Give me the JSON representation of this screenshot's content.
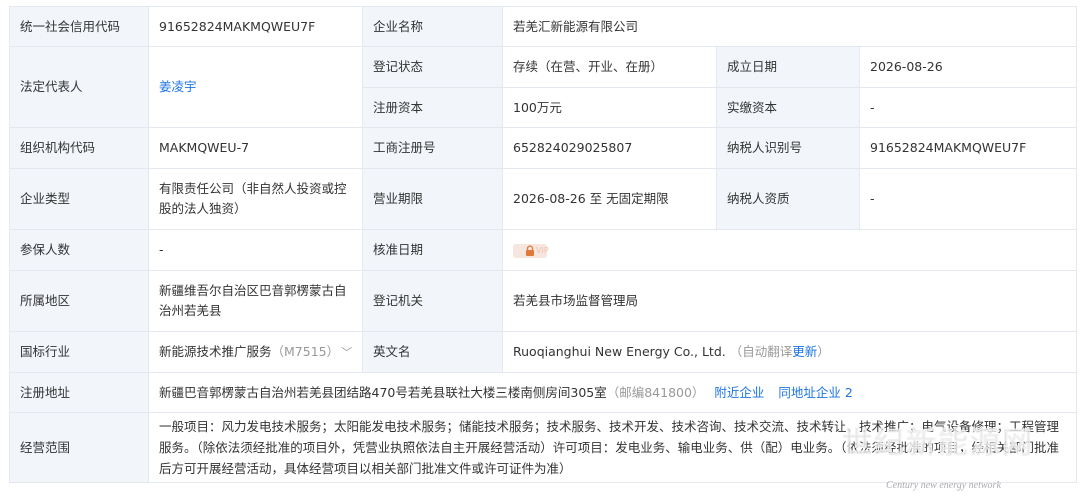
{
  "rows": {
    "credit_code": {
      "label": "统一社会信用代码",
      "value": "91652824MAKMQWEU7F"
    },
    "company_name": {
      "label": "企业名称",
      "value": "若羌汇新能源有限公司"
    },
    "legal_rep": {
      "label": "法定代表人",
      "value": "姜凌宇"
    },
    "reg_status": {
      "label": "登记状态",
      "value": "存续（在营、开业、在册）"
    },
    "est_date": {
      "label": "成立日期",
      "value": "2026-08-26"
    },
    "reg_capital": {
      "label": "注册资本",
      "value": "100万元"
    },
    "paid_capital": {
      "label": "实缴资本",
      "value": "-"
    },
    "org_code": {
      "label": "组织机构代码",
      "value": "MAKMQWEU-7"
    },
    "biz_reg_no": {
      "label": "工商注册号",
      "value": "652824029025807"
    },
    "taxpayer_id": {
      "label": "纳税人识别号",
      "value": "91652824MAKMQWEU7F"
    },
    "company_type": {
      "label": "企业类型",
      "value": "有限责任公司（非自然人投资或控股的法人独资）"
    },
    "biz_term": {
      "label": "营业期限",
      "value": "2026-08-26 至 无固定期限"
    },
    "taxpayer_qual": {
      "label": "纳税人资质",
      "value": "-"
    },
    "insured": {
      "label": "参保人数",
      "value": "-"
    },
    "approval_date": {
      "label": "核准日期",
      "value": "VIP"
    },
    "region": {
      "label": "所属地区",
      "value": "新疆维吾尔自治区巴音郭楞蒙古自治州若羌县"
    },
    "reg_authority": {
      "label": "登记机关",
      "value": "若羌县市场监督管理局"
    },
    "industry": {
      "label": "国标行业",
      "value": "新能源技术推广服务",
      "code": "（M7515）"
    },
    "english_name": {
      "label": "英文名",
      "value": "Ruoqianghui New Energy Co., Ltd.",
      "note_prefix": "（自动翻译",
      "note_link": "更新",
      "note_suffix": "）"
    },
    "address": {
      "label": "注册地址",
      "value": "新疆巴音郭楞蒙古自治州若羌县团结路470号若羌县联社大楼三楼南侧房间305室",
      "postcode": "（邮编841800）",
      "nearby": "附近企业",
      "same_addr": "同地址企业",
      "same_addr_count": "2"
    },
    "scope": {
      "label": "经营范围",
      "value": "一般项目：风力发电技术服务；太阳能发电技术服务；储能技术服务；技术服务、技术开发、技术咨询、技术交流、技术转让、技术推广；电气设备修理；工程管理服务。（除依法须经批准的项目外，凭营业执照依法自主开展经营活动）许可项目：发电业务、输电业务、供（配）电业务。（依法须经批准的项目，经相关部门批准后方可开展经营活动，具体经营项目以相关部门批准文件或许可证件为准）"
    }
  },
  "watermark": {
    "title": "世纪新能源网",
    "subtitle": "Century new energy network"
  }
}
